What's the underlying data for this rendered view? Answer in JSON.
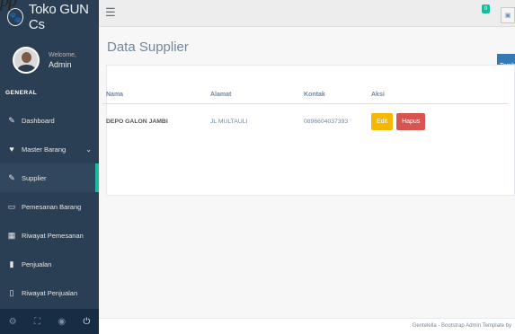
{
  "corner_fragment": "pp",
  "brand": {
    "logo_icon": "paw-icon",
    "title": "Toko GUN Cs"
  },
  "profile": {
    "welcome": "Welcome,",
    "name": "Admin"
  },
  "sidebar": {
    "section_title": "GENERAL",
    "items": [
      {
        "icon": "✎",
        "label": "Dashboard"
      },
      {
        "icon": "♥",
        "label": "Master Barang",
        "chevron": "⌄"
      },
      {
        "icon": "✎",
        "label": "Supplier"
      },
      {
        "icon": "▭",
        "label": "Pemesanan Barang"
      },
      {
        "icon": "▦",
        "label": "Riwayat Pemesanan"
      },
      {
        "icon": "▮",
        "label": "Penjualan"
      },
      {
        "icon": "▯",
        "label": "Riwayat Penjualan"
      }
    ],
    "footer_icons": [
      "⚙",
      "⛶",
      "◉",
      "⏻"
    ]
  },
  "topnav": {
    "toggle": "☰",
    "notif_count": "0"
  },
  "main": {
    "title": "Data Supplier",
    "add_button": "Tambah",
    "table": {
      "headers": [
        "Nama",
        "Alamat",
        "Kontak",
        "Aksi"
      ],
      "rows": [
        {
          "nama": "DEPO GALON JAMBI",
          "alamat": "JL MULTAULI",
          "kontak": "0896604037393",
          "edit": "Edit",
          "hapus": "Hapus"
        }
      ]
    }
  },
  "footer": {
    "text": "Gentelella - Bootstrap Admin Template by"
  },
  "colors": {
    "sidebar": "#2a3f54",
    "accent": "#1abb9c",
    "primary": "#337ab7",
    "warning": "#f5b800",
    "danger": "#d9534f"
  }
}
